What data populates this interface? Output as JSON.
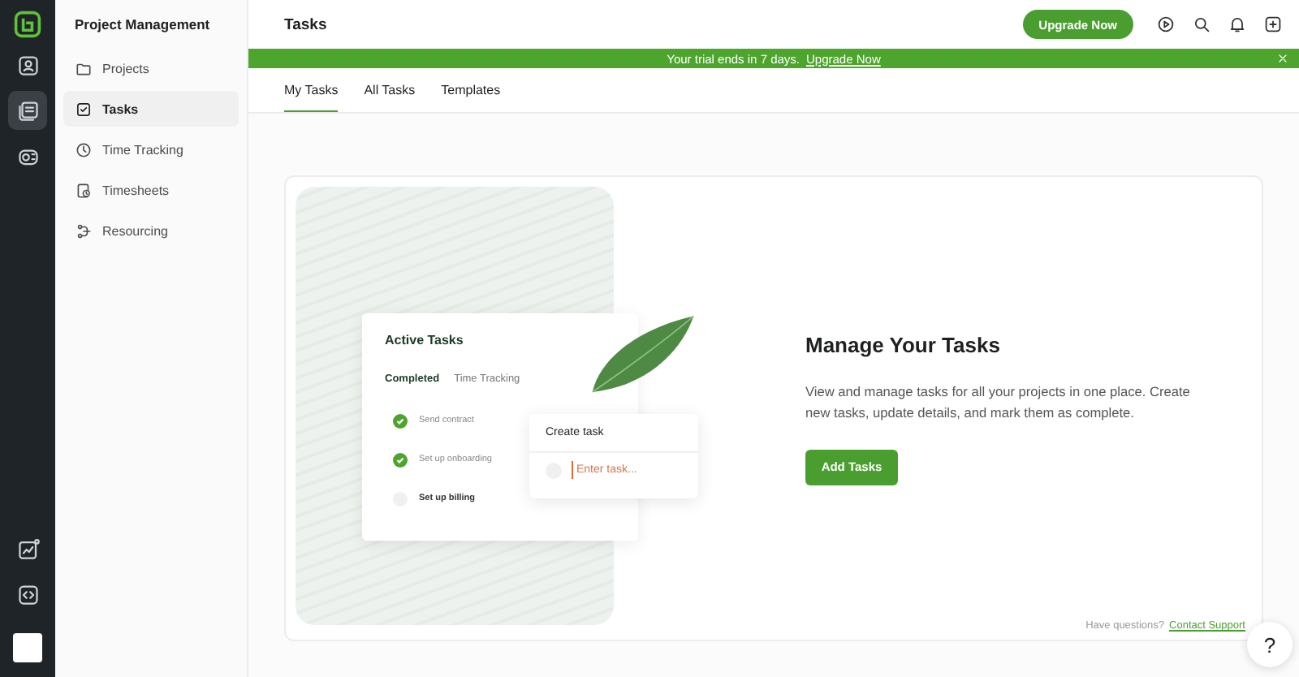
{
  "rail": {
    "items": [
      {
        "kind": "contacts",
        "selected": false
      },
      {
        "kind": "tasks",
        "selected": true
      },
      {
        "kind": "billing",
        "selected": false
      }
    ],
    "bottom_items": [
      {
        "kind": "chart"
      },
      {
        "kind": "code"
      }
    ]
  },
  "sidebar": {
    "title": "Project Management",
    "items": [
      {
        "kind": "folder",
        "label": "Projects",
        "selected": false
      },
      {
        "kind": "check",
        "label": "Tasks",
        "selected": true
      },
      {
        "kind": "clock",
        "label": "Time Tracking",
        "selected": false
      },
      {
        "kind": "sheet",
        "label": "Timesheets",
        "selected": false
      },
      {
        "kind": "resource",
        "label": "Resourcing",
        "selected": false
      }
    ]
  },
  "header": {
    "title": "Tasks",
    "upgrade_button": "Upgrade Now"
  },
  "banner": {
    "text": "Your trial ends in 7 days.",
    "link": "Upgrade Now"
  },
  "tabs": [
    {
      "label": "My Tasks",
      "selected": true
    },
    {
      "label": "All Tasks",
      "selected": false
    },
    {
      "label": "Templates",
      "selected": false
    }
  ],
  "empty_state": {
    "illustration": {
      "title": "Active Tasks",
      "tabs": [
        {
          "label": "Completed",
          "selected": true
        },
        {
          "label": "Time Tracking",
          "selected": false
        }
      ],
      "tasks": [
        {
          "label": "Send contract",
          "checked": true
        },
        {
          "label": "Set up onboarding",
          "checked": true
        },
        {
          "label": "Set up billing",
          "checked": false
        }
      ],
      "create_task": {
        "title": "Create task",
        "placeholder": "Enter task..."
      }
    },
    "heading": "Manage Your Tasks",
    "description": "View and manage tasks for all your projects in one place. Create new tasks, update details, and mark them as complete.",
    "button": "Add Tasks",
    "footer": {
      "text": "Have questions?",
      "link": "Contact Support"
    }
  },
  "help_button": "?"
}
